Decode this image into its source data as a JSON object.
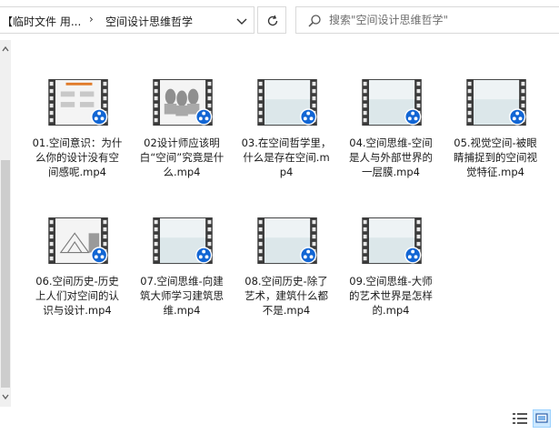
{
  "address": {
    "crumb_parent": "【临时文件 用...",
    "separator": "›",
    "crumb_current": "空间设计思维哲学"
  },
  "search": {
    "placeholder": "搜索\"空间设计思维哲学\""
  },
  "files": [
    {
      "label": "01.空间意识：为什么你的设计没有空间感呢.mp4",
      "thumb": "content-slide"
    },
    {
      "label": "02设计师应该明白“空间”究竟是什么.mp4",
      "thumb": "sculptures"
    },
    {
      "label": "03.在空间哲学里，什么是存在空间.mp4",
      "thumb": "blank-frame"
    },
    {
      "label": "04.空间思维-空间是人与外部世界的一层膜.mp4",
      "thumb": "blank-frame"
    },
    {
      "label": "05.视觉空间-被眼睛捕捉到的空间视觉特征.mp4",
      "thumb": "blank-frame"
    },
    {
      "label": "06.空间历史-历史上人们对空间的认识与设计.mp4",
      "thumb": "architecture-sketch"
    },
    {
      "label": "07.空间思维-向建筑大师学习建筑思维.mp4",
      "thumb": "blank-frame"
    },
    {
      "label": "08.空间历史-除了艺术，建筑什么都不是.mp4",
      "thumb": "blank-frame"
    },
    {
      "label": "09.空间思维-大师的艺术世界是怎样的.mp4",
      "thumb": "blank-frame"
    }
  ],
  "icons": {
    "player_badge": "media-player-icon",
    "refresh": "refresh-icon",
    "search": "search-icon",
    "dropdown": "chevron-down-icon",
    "view_details": "details-view-icon",
    "view_thumbnails": "large-icons-view-icon"
  },
  "colors": {
    "badge_blue": "#1266d4",
    "film_dark": "#3b3b3b",
    "selected_view": "#cce8ff"
  }
}
